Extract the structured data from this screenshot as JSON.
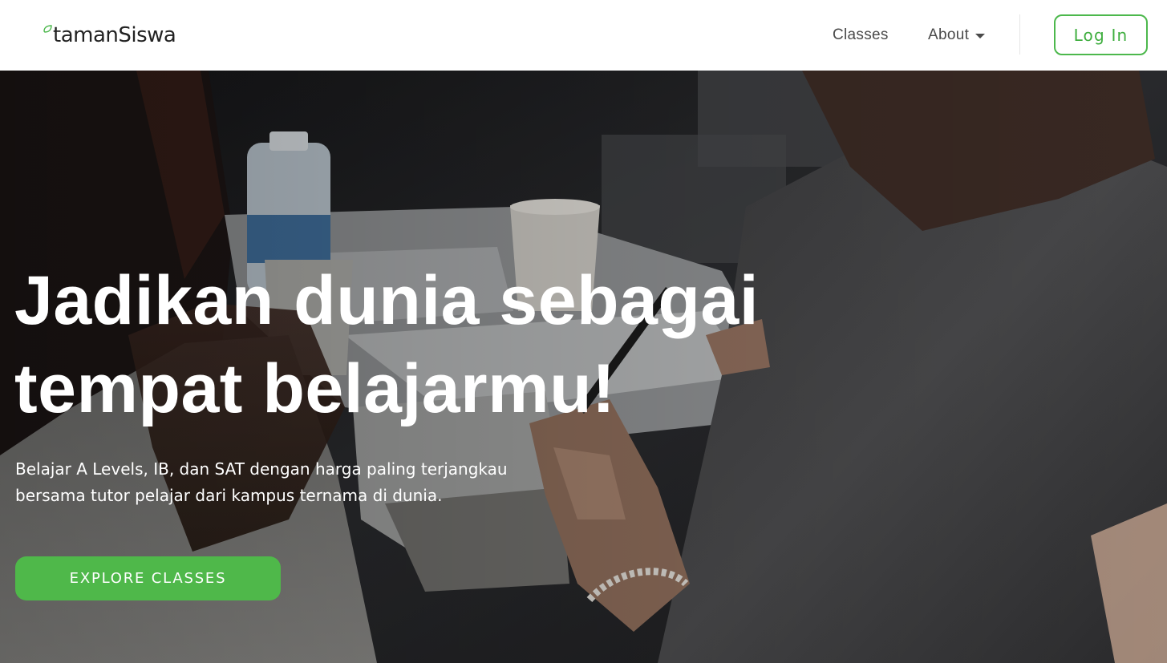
{
  "brand": {
    "name_part1": "taman",
    "name_part2": "Siswa",
    "accent_color": "#4cb84c"
  },
  "nav": {
    "classes_label": "Classes",
    "about_label": "About",
    "login_label": "Log In"
  },
  "hero": {
    "title_line1": "Jadikan dunia sebagai",
    "title_line2": "tempat belajarmu!",
    "subtitle": "Belajar A Levels, IB, dan SAT dengan harga paling terjangkau bersama tutor pelajar dari kampus ternama di dunia.",
    "cta_label": "EXPLORE CLASSES",
    "cta_color": "#4fb84a"
  }
}
